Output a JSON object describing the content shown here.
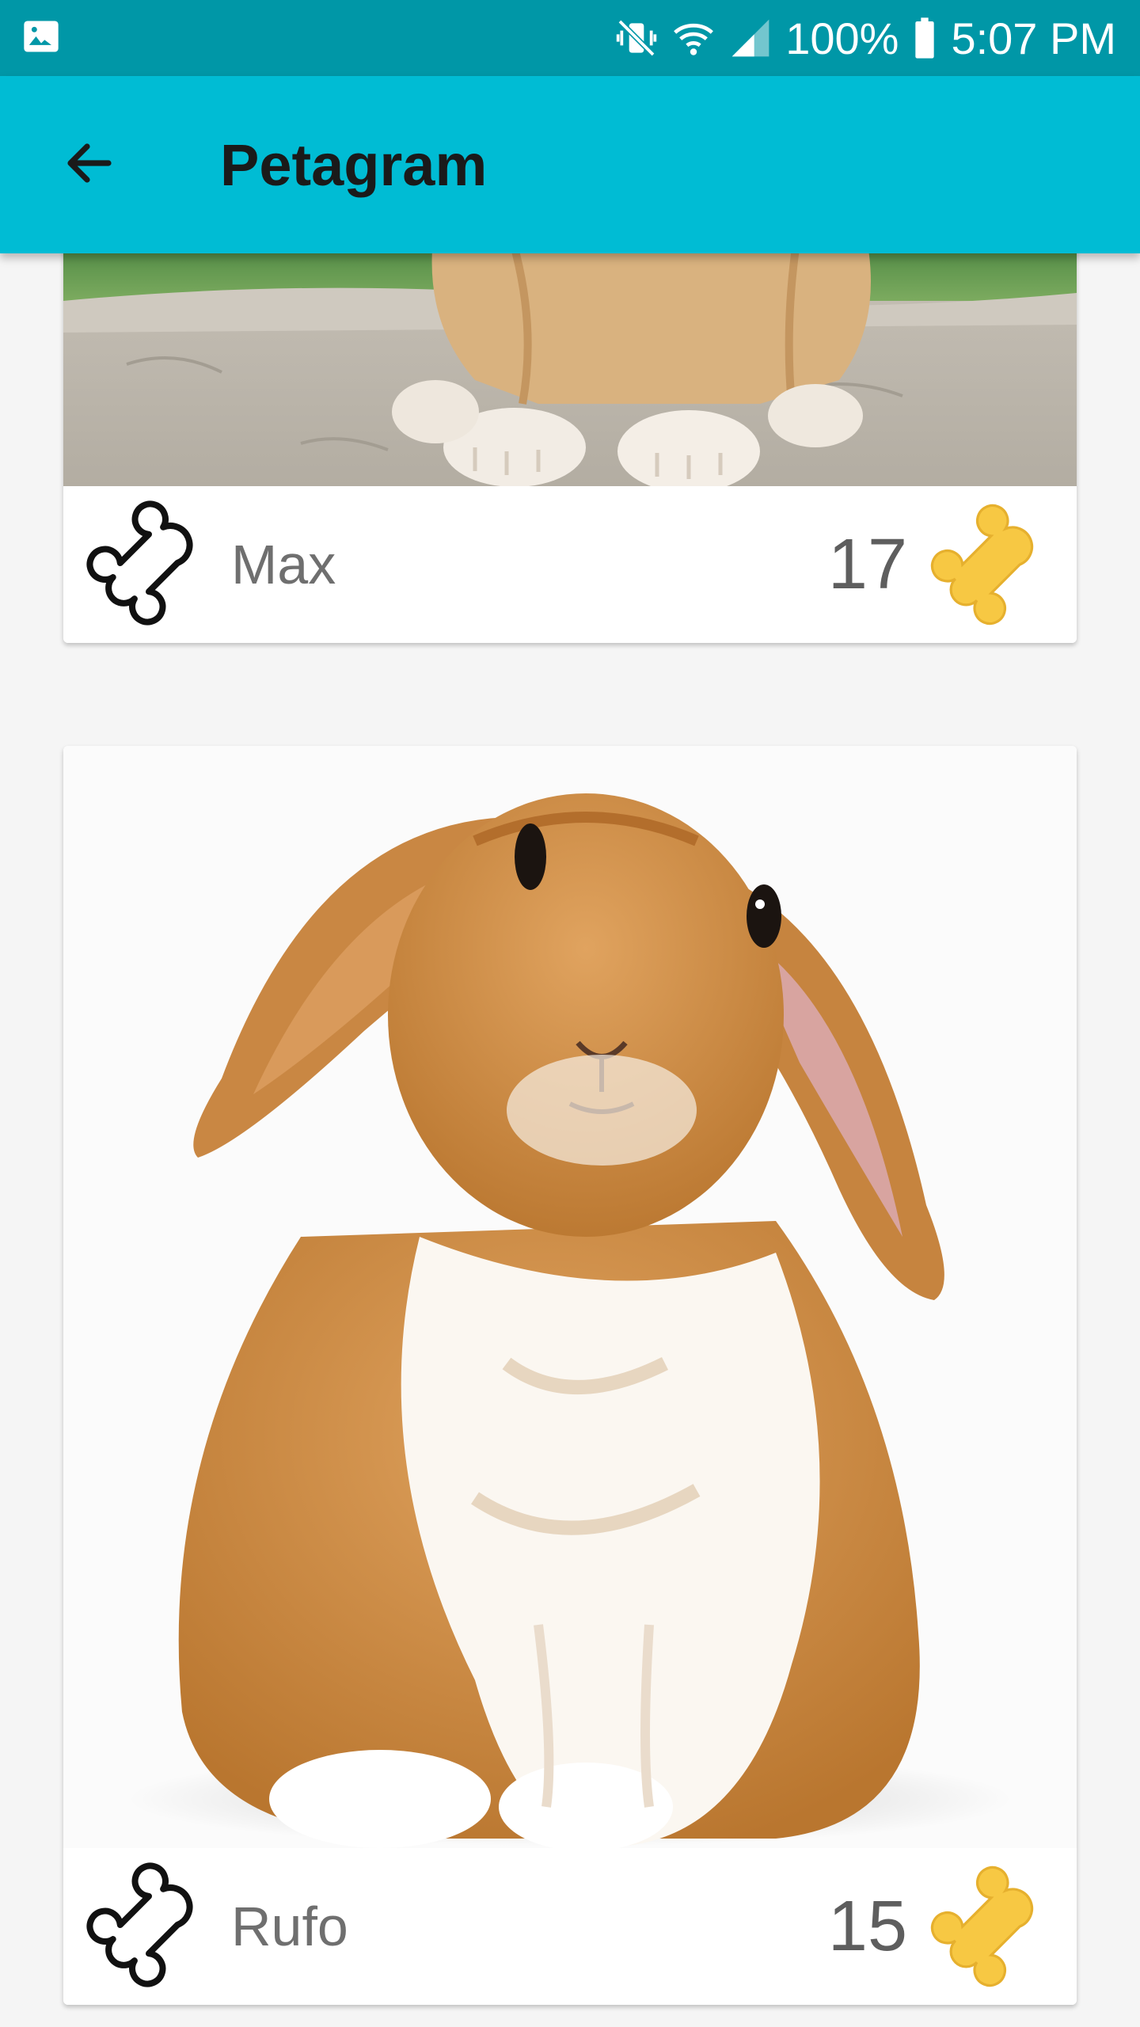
{
  "status_bar": {
    "battery": "100%",
    "time": "5:07 PM",
    "icons": [
      "image-icon",
      "mute-vibrate-icon",
      "wifi-icon",
      "signal-icon",
      "battery-icon"
    ],
    "color": "#0097a7"
  },
  "app_bar": {
    "title": "Petagram",
    "back_icon": "arrow-left-icon",
    "color": "#00bcd4"
  },
  "pets": [
    {
      "name": "Max",
      "likes": "17"
    },
    {
      "name": "Rufo",
      "likes": "15"
    }
  ],
  "colors": {
    "bone_gold": "#f7c843",
    "bone_outline": "#111111"
  }
}
